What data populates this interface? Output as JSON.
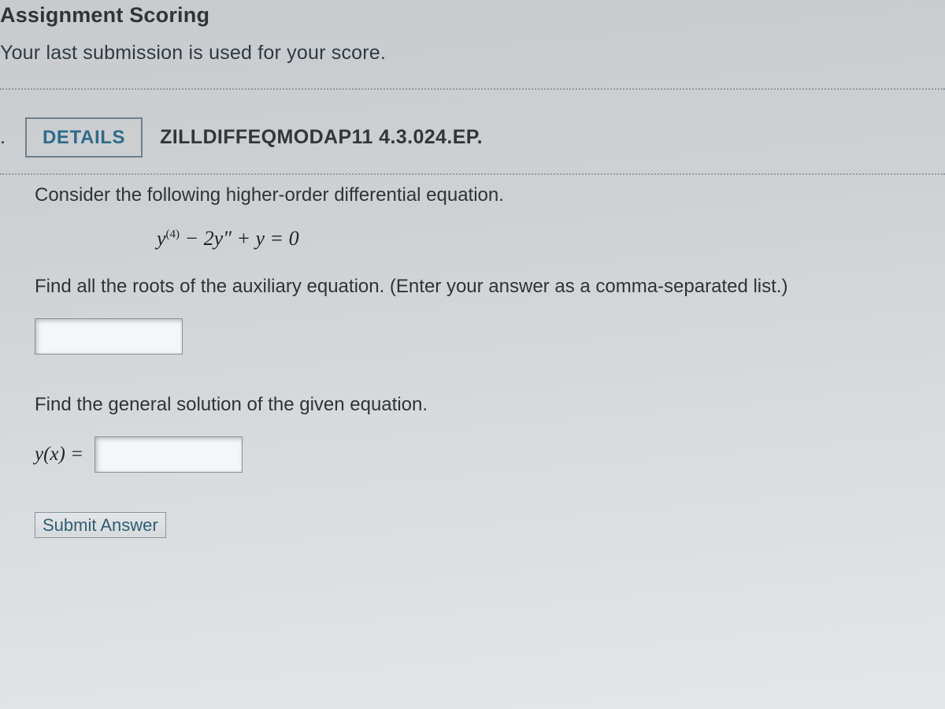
{
  "header": {
    "title": "Assignment Scoring",
    "note": "Your last submission is used for your score."
  },
  "question": {
    "number_suffix": ".",
    "details_label": "DETAILS",
    "code": "ZILLDIFFEQMODAP11 4.3.024.EP.",
    "intro": "Consider the following higher-order differential equation.",
    "equation_y": "y",
    "equation_sup4": "(4)",
    "equation_mid": " − 2y″ + y = 0",
    "part1": "Find all the roots of the auxiliary equation. (Enter your answer as a comma-separated list.)",
    "part2": "Find the general solution of the given equation.",
    "yx_label": "y(x) =",
    "submit_label": "Submit Answer"
  }
}
